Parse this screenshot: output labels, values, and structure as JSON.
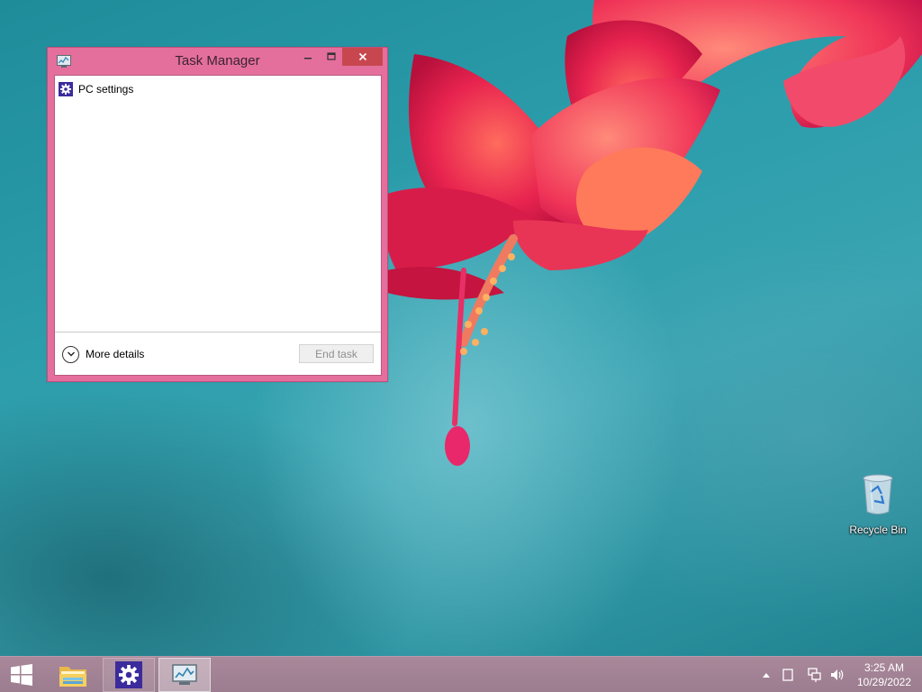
{
  "task_manager": {
    "title": "Task Manager",
    "processes": [
      {
        "name": "PC settings",
        "icon": "gear-icon"
      }
    ],
    "more_details_label": "More details",
    "end_task_label": "End task"
  },
  "desktop": {
    "icons": [
      {
        "label": "Recycle Bin",
        "icon": "recycle-bin-icon"
      }
    ]
  },
  "taskbar": {
    "pinned": [
      {
        "name": "File Explorer",
        "icon": "folder-icon"
      },
      {
        "name": "PC settings",
        "icon": "gear-icon"
      },
      {
        "name": "Task Manager",
        "icon": "task-manager-icon"
      }
    ],
    "clock": {
      "time": "3:25 AM",
      "date": "10/29/2022"
    }
  },
  "colors": {
    "window_frame": "#e46f9c",
    "close_button": "#c8474f",
    "settings_icon_bg": "#3b2b9c",
    "taskbar": "#a3849a",
    "desktop": "#2c9dab"
  }
}
